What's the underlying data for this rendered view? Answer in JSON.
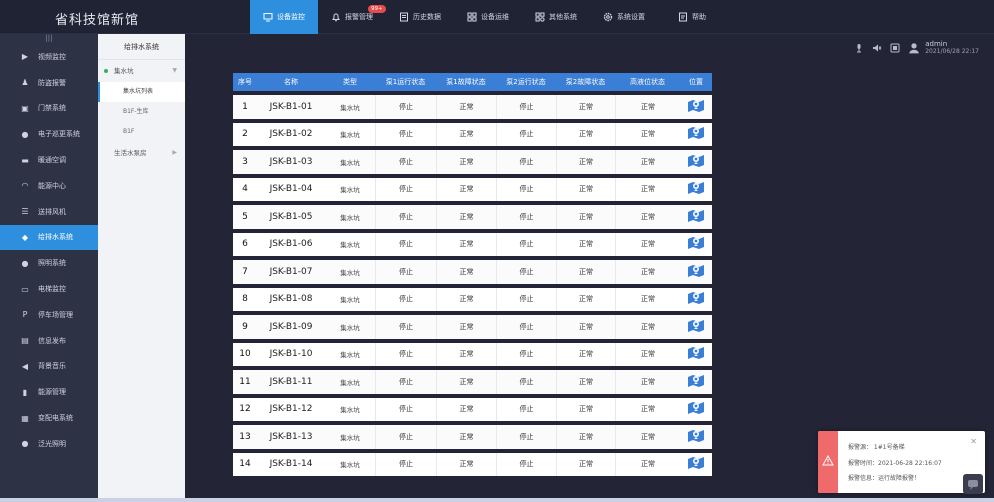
{
  "app": {
    "title": "省科技馆新馆"
  },
  "nav": [
    {
      "label": "设备监控",
      "icon": "monitor-icon",
      "active": true
    },
    {
      "label": "报警管理",
      "icon": "bell-icon",
      "badge": "99+"
    },
    {
      "label": "历史数据",
      "icon": "history-icon"
    },
    {
      "label": "设备运维",
      "icon": "grid-icon"
    },
    {
      "label": "其他系统",
      "icon": "apps-icon"
    },
    {
      "label": "系统设置",
      "icon": "gear-icon"
    },
    {
      "label": "帮助",
      "icon": "help-icon"
    }
  ],
  "sidebar": {
    "items": [
      {
        "label": "视频监控",
        "icon": "video-icon"
      },
      {
        "label": "防盗报警",
        "icon": "alarm-icon"
      },
      {
        "label": "门禁系统",
        "icon": "door-icon"
      },
      {
        "label": "电子巡更系统",
        "icon": "patrol-icon"
      },
      {
        "label": "暖通空调",
        "icon": "hvac-icon"
      },
      {
        "label": "能源中心",
        "icon": "energy-icon"
      },
      {
        "label": "送排风机",
        "icon": "fan-icon"
      },
      {
        "label": "给排水系统",
        "icon": "water-icon",
        "active": true
      },
      {
        "label": "照明系统",
        "icon": "light-icon"
      },
      {
        "label": "电梯监控",
        "icon": "elevator-icon"
      },
      {
        "label": "停车场管理",
        "icon": "parking-icon"
      },
      {
        "label": "信息发布",
        "icon": "info-icon"
      },
      {
        "label": "背景音乐",
        "icon": "music-icon"
      },
      {
        "label": "能源管理",
        "icon": "chart-icon"
      },
      {
        "label": "变配电系统",
        "icon": "power-icon"
      },
      {
        "label": "泛光照明",
        "icon": "floodlight-icon"
      }
    ]
  },
  "submenu": {
    "title": "给排水系统",
    "group1": "集水坑",
    "items": [
      "集水坑列表",
      "B1F-生库",
      "B1F"
    ],
    "group2": "生活水泵房"
  },
  "user": {
    "name": "admin",
    "time": "2021/06/28  22:17"
  },
  "table": {
    "headers": [
      "序号",
      "名称",
      "类型",
      "泵1运行状态",
      "泵1故障状态",
      "泵2运行状态",
      "泵2故障状态",
      "高液位状态",
      "位置"
    ],
    "rows": [
      [
        "1",
        "JSK-B1-01",
        "集水坑",
        "停止",
        "正常",
        "停止",
        "正常",
        "正常"
      ],
      [
        "2",
        "JSK-B1-02",
        "集水坑",
        "停止",
        "正常",
        "停止",
        "正常",
        "正常"
      ],
      [
        "3",
        "JSK-B1-03",
        "集水坑",
        "停止",
        "正常",
        "停止",
        "正常",
        "正常"
      ],
      [
        "4",
        "JSK-B1-04",
        "集水坑",
        "停止",
        "正常",
        "停止",
        "正常",
        "正常"
      ],
      [
        "5",
        "JSK-B1-05",
        "集水坑",
        "停止",
        "正常",
        "停止",
        "正常",
        "正常"
      ],
      [
        "6",
        "JSK-B1-06",
        "集水坑",
        "停止",
        "正常",
        "停止",
        "正常",
        "正常"
      ],
      [
        "7",
        "JSK-B1-07",
        "集水坑",
        "停止",
        "正常",
        "停止",
        "正常",
        "正常"
      ],
      [
        "8",
        "JSK-B1-08",
        "集水坑",
        "停止",
        "正常",
        "停止",
        "正常",
        "正常"
      ],
      [
        "9",
        "JSK-B1-09",
        "集水坑",
        "停止",
        "正常",
        "停止",
        "正常",
        "正常"
      ],
      [
        "10",
        "JSK-B1-10",
        "集水坑",
        "停止",
        "正常",
        "停止",
        "正常",
        "正常"
      ],
      [
        "11",
        "JSK-B1-11",
        "集水坑",
        "停止",
        "正常",
        "停止",
        "正常",
        "正常"
      ],
      [
        "12",
        "JSK-B1-12",
        "集水坑",
        "停止",
        "正常",
        "停止",
        "正常",
        "正常"
      ],
      [
        "13",
        "JSK-B1-13",
        "集水坑",
        "停止",
        "正常",
        "停止",
        "正常",
        "正常"
      ],
      [
        "14",
        "JSK-B1-14",
        "集水坑",
        "停止",
        "正常",
        "停止",
        "正常",
        "正常"
      ]
    ]
  },
  "alarm": {
    "line1": "报警源：  1#1号备梯",
    "line2": "报警时间：2021-06-28 22:16:07",
    "line3": "报警信息：运行故障报警！"
  },
  "colors": {
    "accent": "#2f8fdf",
    "header": "#3a7ed6",
    "alarm": "#ef6b6b"
  }
}
